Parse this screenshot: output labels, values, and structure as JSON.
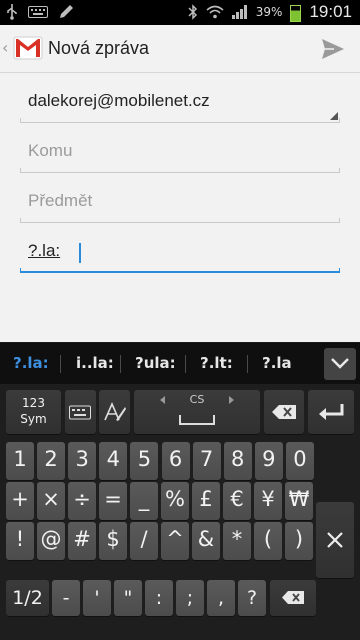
{
  "status_bar": {
    "battery_percent": "39%",
    "time": "19:01",
    "icons": [
      "usb-icon",
      "keyboard-icon",
      "pencil-icon",
      "bluetooth-icon",
      "wifi-icon",
      "signal-icon",
      "battery-icon"
    ]
  },
  "action_bar": {
    "title": "Nová zpráva",
    "icons": [
      "gmail-icon",
      "send-icon"
    ]
  },
  "compose": {
    "from": "dalekorej@mobilenet.cz",
    "to_placeholder": "Komu",
    "subject_placeholder": "Předmět",
    "body_text": "?.la:"
  },
  "suggestions": {
    "items": [
      "?.la:",
      "i..la:",
      "?ula:",
      "?.lt:",
      "?.la"
    ],
    "active_index": 0
  },
  "keyboard": {
    "row1": {
      "sym_key_top": "123",
      "sym_key_bottom": "Sym",
      "space_lang": "CS"
    },
    "row2": [
      "1",
      "2",
      "3",
      "4",
      "5",
      "6",
      "7",
      "8",
      "9",
      "0"
    ],
    "row3": [
      "+",
      "×",
      "÷",
      "=",
      "_",
      "%",
      "£",
      "€",
      "¥",
      "₩"
    ],
    "row4": [
      "!",
      "@",
      "#",
      "$",
      "/",
      "^",
      "&",
      "*",
      "(",
      ")"
    ],
    "row5": [
      "1/2",
      "-",
      "'",
      "\"",
      ":",
      ";",
      ",",
      "?"
    ],
    "colors": {
      "accent": "#2a8bd8",
      "key_bg": "#555555",
      "keyboard_bg": "#1e1e1e"
    }
  }
}
